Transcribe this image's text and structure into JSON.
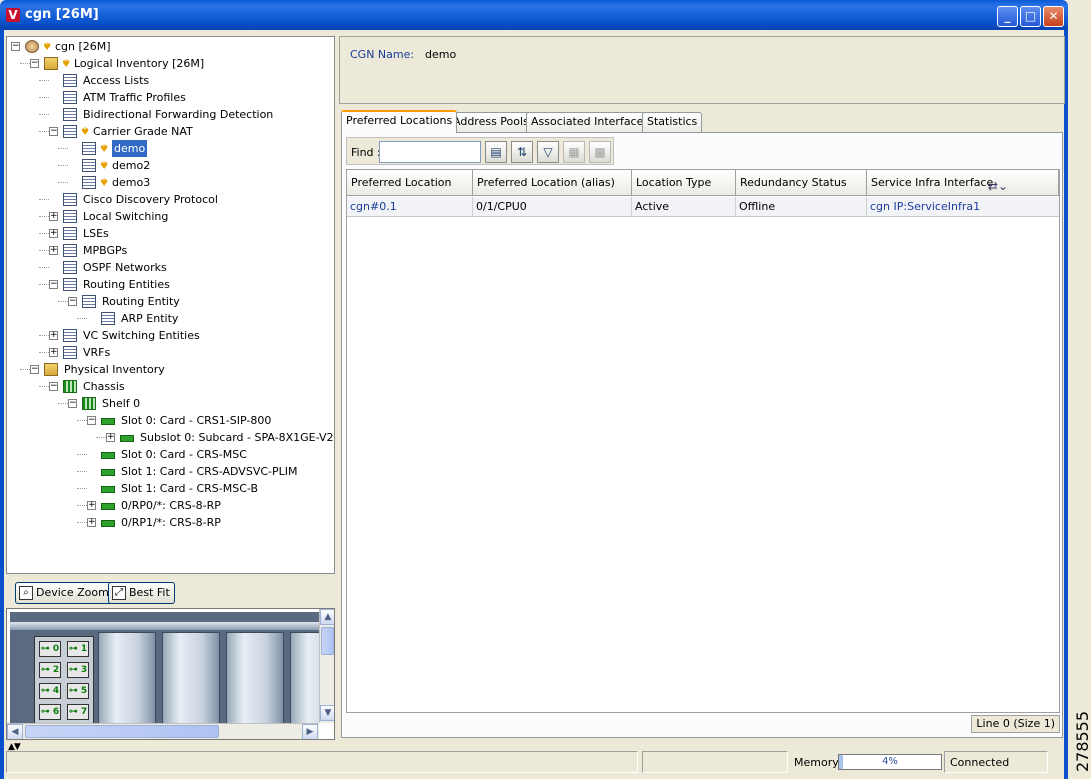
{
  "window": {
    "title": "cgn [26M]",
    "app_letter": "V",
    "minimize": "_",
    "maximize": "□",
    "close": "✕"
  },
  "side_stamp": "278555",
  "tree": [
    {
      "label": "cgn [26M]",
      "level": 0,
      "expander": "minus",
      "icon": "globe",
      "bell": true
    },
    {
      "label": "Logical Inventory [26M]",
      "level": 1,
      "expander": "minus",
      "icon": "folder",
      "bell": true
    },
    {
      "label": "Access Lists",
      "level": 2,
      "expander": "",
      "icon": "table",
      "bell": false
    },
    {
      "label": "ATM Traffic Profiles",
      "level": 2,
      "expander": "",
      "icon": "table",
      "bell": false
    },
    {
      "label": "Bidirectional Forwarding Detection",
      "level": 2,
      "expander": "",
      "icon": "table",
      "bell": false
    },
    {
      "label": "Carrier Grade NAT",
      "level": 2,
      "expander": "minus",
      "icon": "table",
      "bell": true
    },
    {
      "label": "demo",
      "level": 3,
      "expander": "",
      "icon": "table",
      "bell": true,
      "selected": true
    },
    {
      "label": "demo2",
      "level": 3,
      "expander": "",
      "icon": "table",
      "bell": true
    },
    {
      "label": "demo3",
      "level": 3,
      "expander": "",
      "icon": "table",
      "bell": true
    },
    {
      "label": "Cisco Discovery Protocol",
      "level": 2,
      "expander": "",
      "icon": "table",
      "bell": false
    },
    {
      "label": "Local Switching",
      "level": 2,
      "expander": "plus",
      "icon": "table",
      "bell": false
    },
    {
      "label": "LSEs",
      "level": 2,
      "expander": "plus",
      "icon": "table",
      "bell": false
    },
    {
      "label": "MPBGPs",
      "level": 2,
      "expander": "plus",
      "icon": "table",
      "bell": false
    },
    {
      "label": "OSPF Networks",
      "level": 2,
      "expander": "",
      "icon": "table",
      "bell": false
    },
    {
      "label": "Routing Entities",
      "level": 2,
      "expander": "minus",
      "icon": "table",
      "bell": false
    },
    {
      "label": "Routing Entity",
      "level": 3,
      "expander": "minus",
      "icon": "table",
      "bell": false
    },
    {
      "label": "ARP Entity",
      "level": 4,
      "expander": "",
      "icon": "table",
      "bell": false
    },
    {
      "label": "VC Switching Entities",
      "level": 2,
      "expander": "plus",
      "icon": "table",
      "bell": false
    },
    {
      "label": "VRFs",
      "level": 2,
      "expander": "plus",
      "icon": "table",
      "bell": false
    },
    {
      "label": "Physical Inventory",
      "level": 1,
      "expander": "minus",
      "icon": "folder",
      "bell": false
    },
    {
      "label": "Chassis",
      "level": 2,
      "expander": "minus",
      "icon": "chassis",
      "bell": false
    },
    {
      "label": "Shelf 0",
      "level": 3,
      "expander": "minus",
      "icon": "chassis",
      "bell": false
    },
    {
      "label": "Slot 0: Card - CRS1-SIP-800",
      "level": 4,
      "expander": "minus",
      "icon": "card",
      "bell": false
    },
    {
      "label": "Subslot 0: Subcard - SPA-8X1GE-V2",
      "level": 5,
      "expander": "plus",
      "icon": "card",
      "bell": false
    },
    {
      "label": "Slot 0: Card - CRS-MSC",
      "level": 4,
      "expander": "",
      "icon": "card",
      "bell": false
    },
    {
      "label": "Slot 1: Card - CRS-ADVSVC-PLIM",
      "level": 4,
      "expander": "",
      "icon": "card",
      "bell": false
    },
    {
      "label": "Slot 1: Card - CRS-MSC-B",
      "level": 4,
      "expander": "",
      "icon": "card",
      "bell": false
    },
    {
      "label": "0/RP0/*: CRS-8-RP",
      "level": 4,
      "expander": "plus",
      "icon": "card",
      "bell": false
    },
    {
      "label": "0/RP1/*: CRS-8-RP",
      "level": 4,
      "expander": "plus",
      "icon": "card",
      "bell": false
    }
  ],
  "zoom": {
    "device_zoom": "Device Zoom",
    "best_fit": "Best Fit"
  },
  "overview": {
    "ports": [
      "0",
      "1",
      "2",
      "3",
      "4",
      "5",
      "6",
      "7"
    ]
  },
  "details": {
    "name_label": "CGN Name:",
    "name_value": "demo"
  },
  "tabs": [
    {
      "label": "Preferred Locations",
      "active": true
    },
    {
      "label": "Address Pools",
      "active": false
    },
    {
      "label": "Associated Interfaces",
      "active": false
    },
    {
      "label": "Statistics",
      "active": false
    }
  ],
  "find": {
    "label": "Find :",
    "value": ""
  },
  "toolbar_icons": [
    "save-icon",
    "sort-icon",
    "filter-icon",
    "export-icon",
    "print-icon"
  ],
  "table": {
    "columns": [
      "Preferred Location",
      "Preferred Location (alias)",
      "Location Type",
      "Redundancy Status",
      "Service Infra Interface"
    ],
    "rows": [
      [
        "cgn#0.1",
        "0/1/CPU0",
        "Active",
        "Offline",
        "cgn IP:ServiceInfra1"
      ]
    ],
    "footer": "Line 0 (Size 1)"
  },
  "status": {
    "memory_label": "Memory:",
    "memory_value": "4%",
    "memory_fraction": 0.04,
    "connection": "Connected"
  }
}
